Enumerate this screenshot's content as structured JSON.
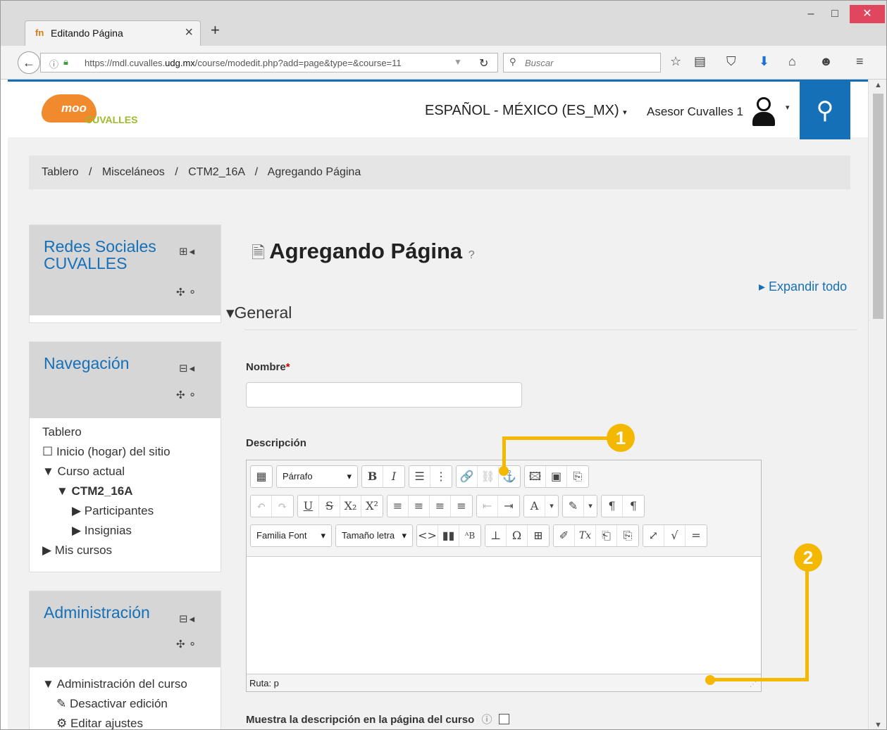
{
  "browser": {
    "tab_title": "Editando Página",
    "tab_favicon": "fn",
    "tab_close": "×",
    "new_tab": "+",
    "url_host_pre": "https://mdl.cuvalles.",
    "url_host_bold": "udg.mx",
    "url_path": "/course/modedit.php?add=page&type=&course=11",
    "search_placeholder": "Buscar",
    "window_controls": [
      "–",
      "□",
      "✕"
    ]
  },
  "site": {
    "logo_text": "moo",
    "logo_sub": "CUVALLES",
    "language": "ESPAÑOL - MÉXICO (ES_MX)",
    "language_caret": "▾",
    "user_name": "Asesor Cuvalles 1",
    "search_icon_glyph": "⚲"
  },
  "breadcrumb": {
    "items": [
      "Tablero",
      "Misceláneos",
      "CTM2_16A",
      "Agregando Página"
    ],
    "separator": "/"
  },
  "blocks": {
    "redes": {
      "title_line1": "Redes Sociales",
      "title_line2": "CUVALLES",
      "icons": "⊞◂",
      "move": "✣ ⚬"
    },
    "navegacion": {
      "title": "Navegación",
      "icons": "⊟◂",
      "move": "✣ ⚬",
      "items": [
        "Tablero",
        "☐ Inicio (hogar) del sitio",
        "▼ Curso actual",
        "▼ CTM2_16A",
        "▶ Participantes",
        "▶ Insignias",
        "▶ Mis cursos"
      ]
    },
    "administracion": {
      "title": "Administración",
      "icons": "⊟◂",
      "move": "✣ ⚬",
      "items": [
        "▼ Administración del curso",
        "✎ Desactivar edición",
        "⚙ Editar ajustes"
      ]
    }
  },
  "form": {
    "page_title": "Agregando Página",
    "page_icon": "🗎",
    "help_glyph": "?",
    "expand_all": "▸ Expandir todo",
    "section_general": "▾General",
    "name_label": "Nombre",
    "required_mark": "*",
    "name_value": "",
    "description_label": "Descripción",
    "paragraph_select": "Párrafo",
    "font_family_select": "Familia Font",
    "font_size_select": "Tamaño letra",
    "path_label": "Ruta: p",
    "show_description_label": "Muestra la descripción en la página del curso"
  },
  "editor_toolbar": {
    "row1": [
      "▦",
      "B",
      "I",
      "☰",
      "⋮",
      "🔗",
      "⛓",
      "⚓",
      "🖾",
      "▣",
      "⎘"
    ],
    "row2": [
      "↶",
      "↷",
      "U",
      "S",
      "X₂",
      "X²",
      "≡",
      "≡",
      "≡",
      "≡",
      "⇤",
      "⇥",
      "A",
      "▾",
      "✎",
      "▾",
      "¶",
      "¶"
    ],
    "row3": [
      "<>",
      "▮▮",
      "ᴬB",
      "⊥",
      "Ω",
      "⊞",
      "✐",
      "Tx",
      "⎗",
      "⎘",
      "⤢",
      "√",
      "="
    ]
  },
  "callouts": [
    "1",
    "2"
  ],
  "colors": {
    "accent": "#1670b8",
    "callout": "#f5b800",
    "orange": "#f08a2c"
  }
}
